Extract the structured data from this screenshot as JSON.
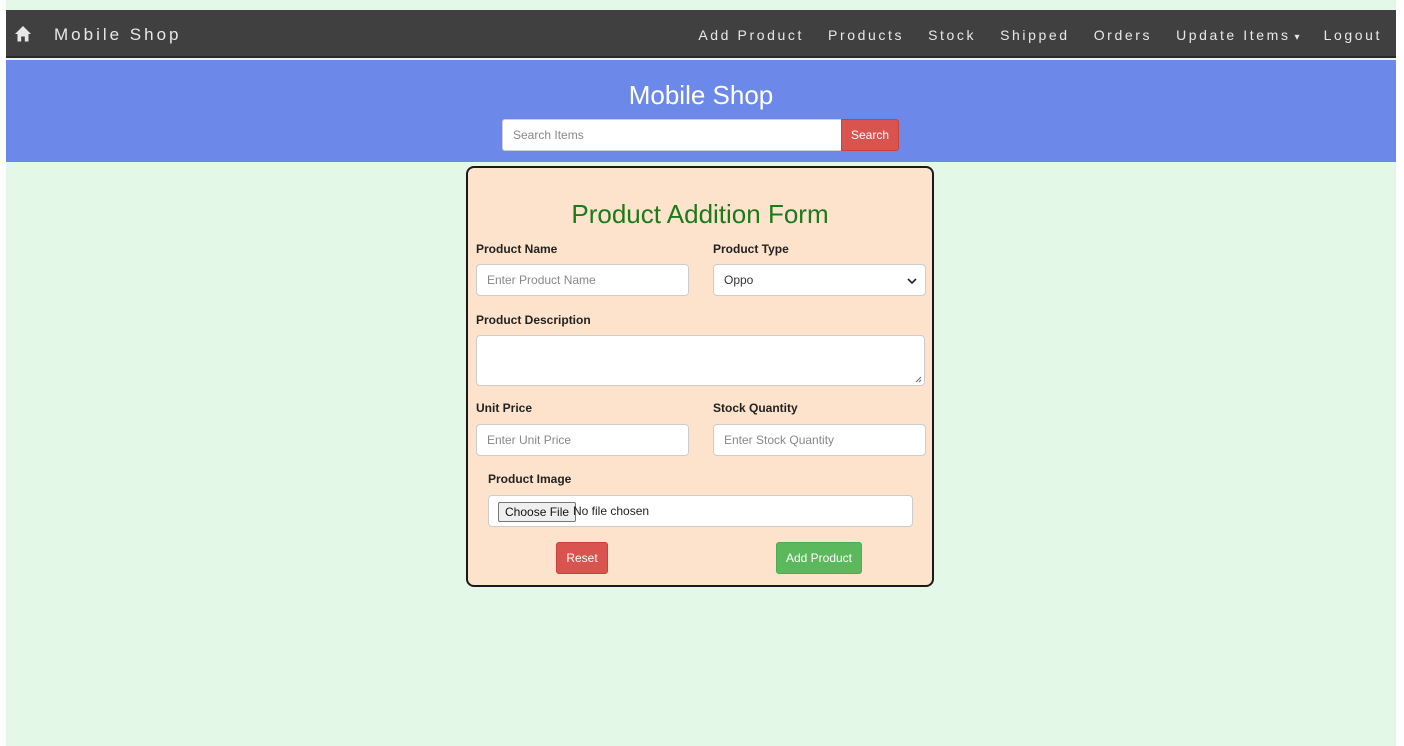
{
  "navbar": {
    "brand": "Mobile Shop",
    "home_icon": "home-icon",
    "links": [
      {
        "label": "Add Product"
      },
      {
        "label": "Products"
      },
      {
        "label": "Stock"
      },
      {
        "label": "Shipped"
      },
      {
        "label": "Orders"
      },
      {
        "label": "Update Items",
        "caret": "▾"
      },
      {
        "label": "Logout"
      }
    ]
  },
  "hero": {
    "title": "Mobile Shop",
    "search_placeholder": "Search Items",
    "search_button": "Search"
  },
  "form": {
    "title": "Product Addition Form",
    "product_name_label": "Product Name",
    "product_name_placeholder": "Enter Product Name",
    "product_type_label": "Product Type",
    "product_type_value": "Oppo",
    "description_label": "Product Description",
    "unit_price_label": "Unit Price",
    "unit_price_placeholder": "Enter Unit Price",
    "stock_quantity_label": "Stock Quantity",
    "stock_quantity_placeholder": "Enter Stock Quantity",
    "image_label": "Product Image",
    "choose_file": "Choose File",
    "no_file": "No file chosen",
    "reset_button": "Reset",
    "add_button": "Add Product"
  },
  "colors": {
    "navbar": "#404041",
    "hero": "#6c89ea",
    "page_bg": "#e3f8e6",
    "form_bg": "#fde3cc",
    "title_green": "#1c7a1c",
    "danger": "#d9534f",
    "success": "#5cb85c"
  }
}
